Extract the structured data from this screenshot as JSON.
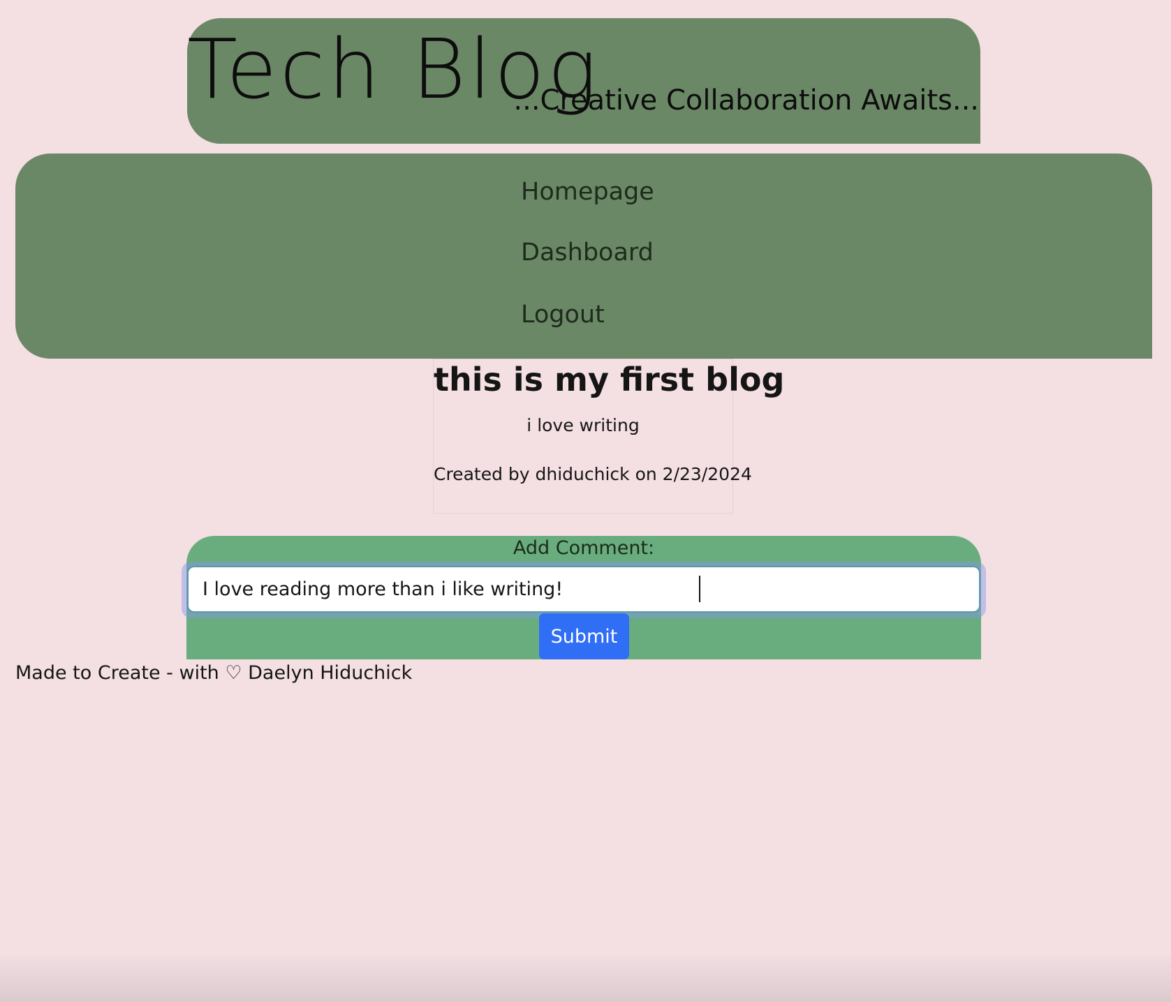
{
  "header": {
    "title": "Tech Blog",
    "tagline": "...Creative Collaboration Awaits..."
  },
  "nav": {
    "items": [
      {
        "label": "Homepage"
      },
      {
        "label": "Dashboard"
      },
      {
        "label": "Logout"
      }
    ]
  },
  "post": {
    "title": "this is my first blog",
    "content": "i love writing",
    "meta": "Created by dhiduchick on 2/23/2024"
  },
  "comment": {
    "label": "Add Comment:",
    "input_value": "I love reading more than i like writing!",
    "submit_label": "Submit"
  },
  "footer": {
    "text": "Made to Create - with ♡ Daelyn Hiduchick"
  },
  "colors": {
    "background": "#f4dfe3",
    "header_bg": "#6b8866",
    "comment_bg": "#69ad7e",
    "submit_bg": "#2f6ef5"
  }
}
